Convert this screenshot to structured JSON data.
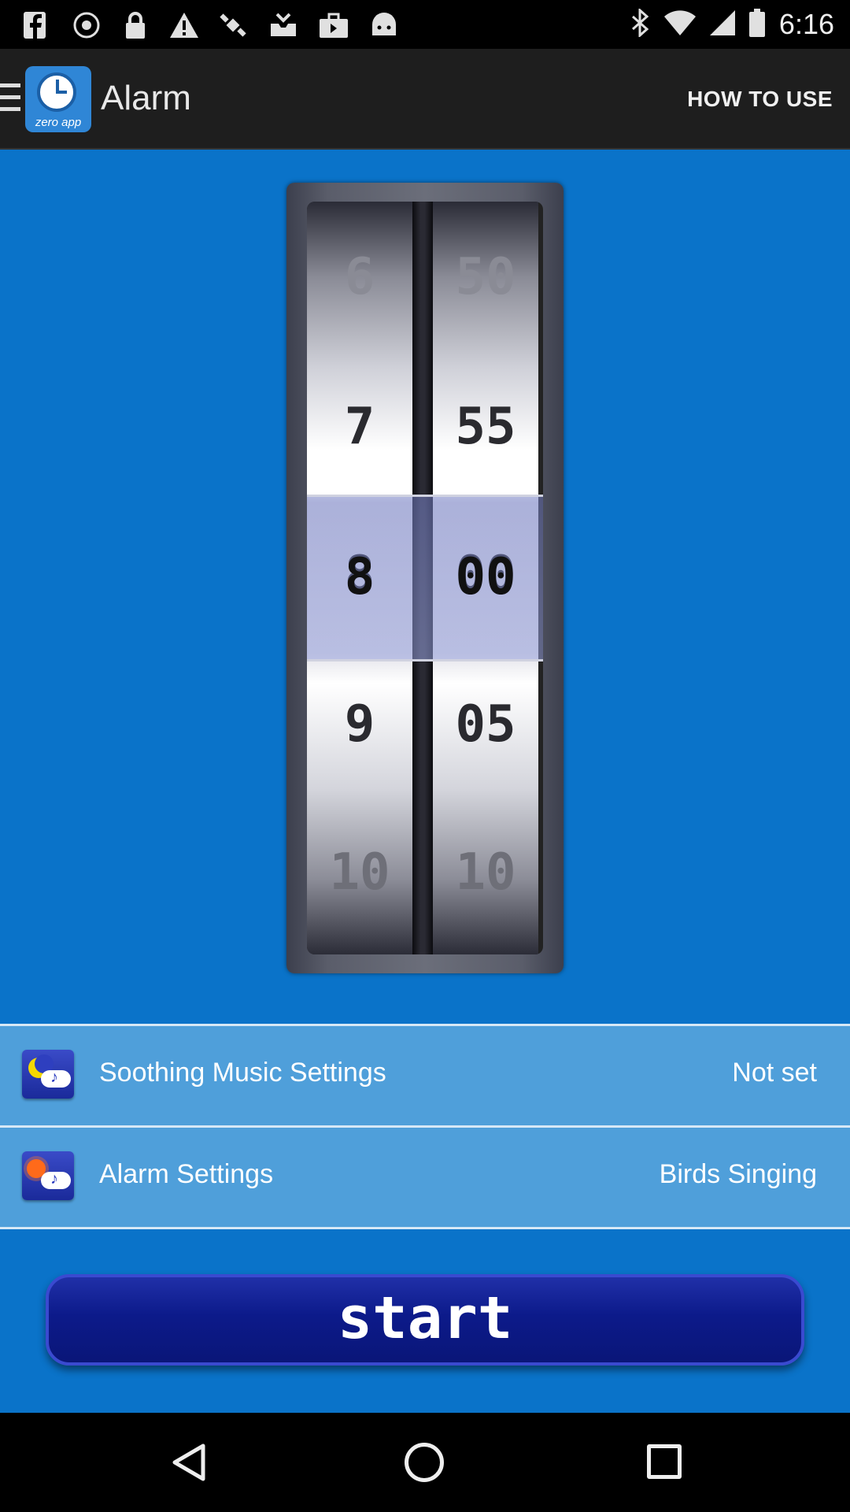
{
  "status_bar": {
    "time": "6:16",
    "left_icons": [
      "facebook-icon",
      "record-icon",
      "lock-icon",
      "warning-icon",
      "satellite-icon",
      "inbox-icon",
      "briefcase-icon",
      "android-icon"
    ],
    "right_icons": [
      "bluetooth-icon",
      "wifi-icon",
      "signal-icon",
      "battery-icon"
    ]
  },
  "app_bar": {
    "title": "Alarm",
    "logo_text": "zero app",
    "how_to_use": "HOW TO USE"
  },
  "picker": {
    "hours": [
      "6",
      "7",
      "8",
      "9",
      "10"
    ],
    "minutes": [
      "50",
      "55",
      "00",
      "05",
      "10"
    ],
    "selected_hour": "8",
    "selected_minute": "00"
  },
  "settings": {
    "soothing_music": {
      "label": "Soothing Music Settings",
      "value": "Not set"
    },
    "alarm": {
      "label": "Alarm Settings",
      "value": "Birds Singing"
    }
  },
  "start_button": {
    "label": "start"
  },
  "colors": {
    "background_blue": "#0a73c9",
    "row_blue": "#4f9fda",
    "button_navy": "#0c1a8a",
    "app_bar": "#1e1e1e"
  }
}
